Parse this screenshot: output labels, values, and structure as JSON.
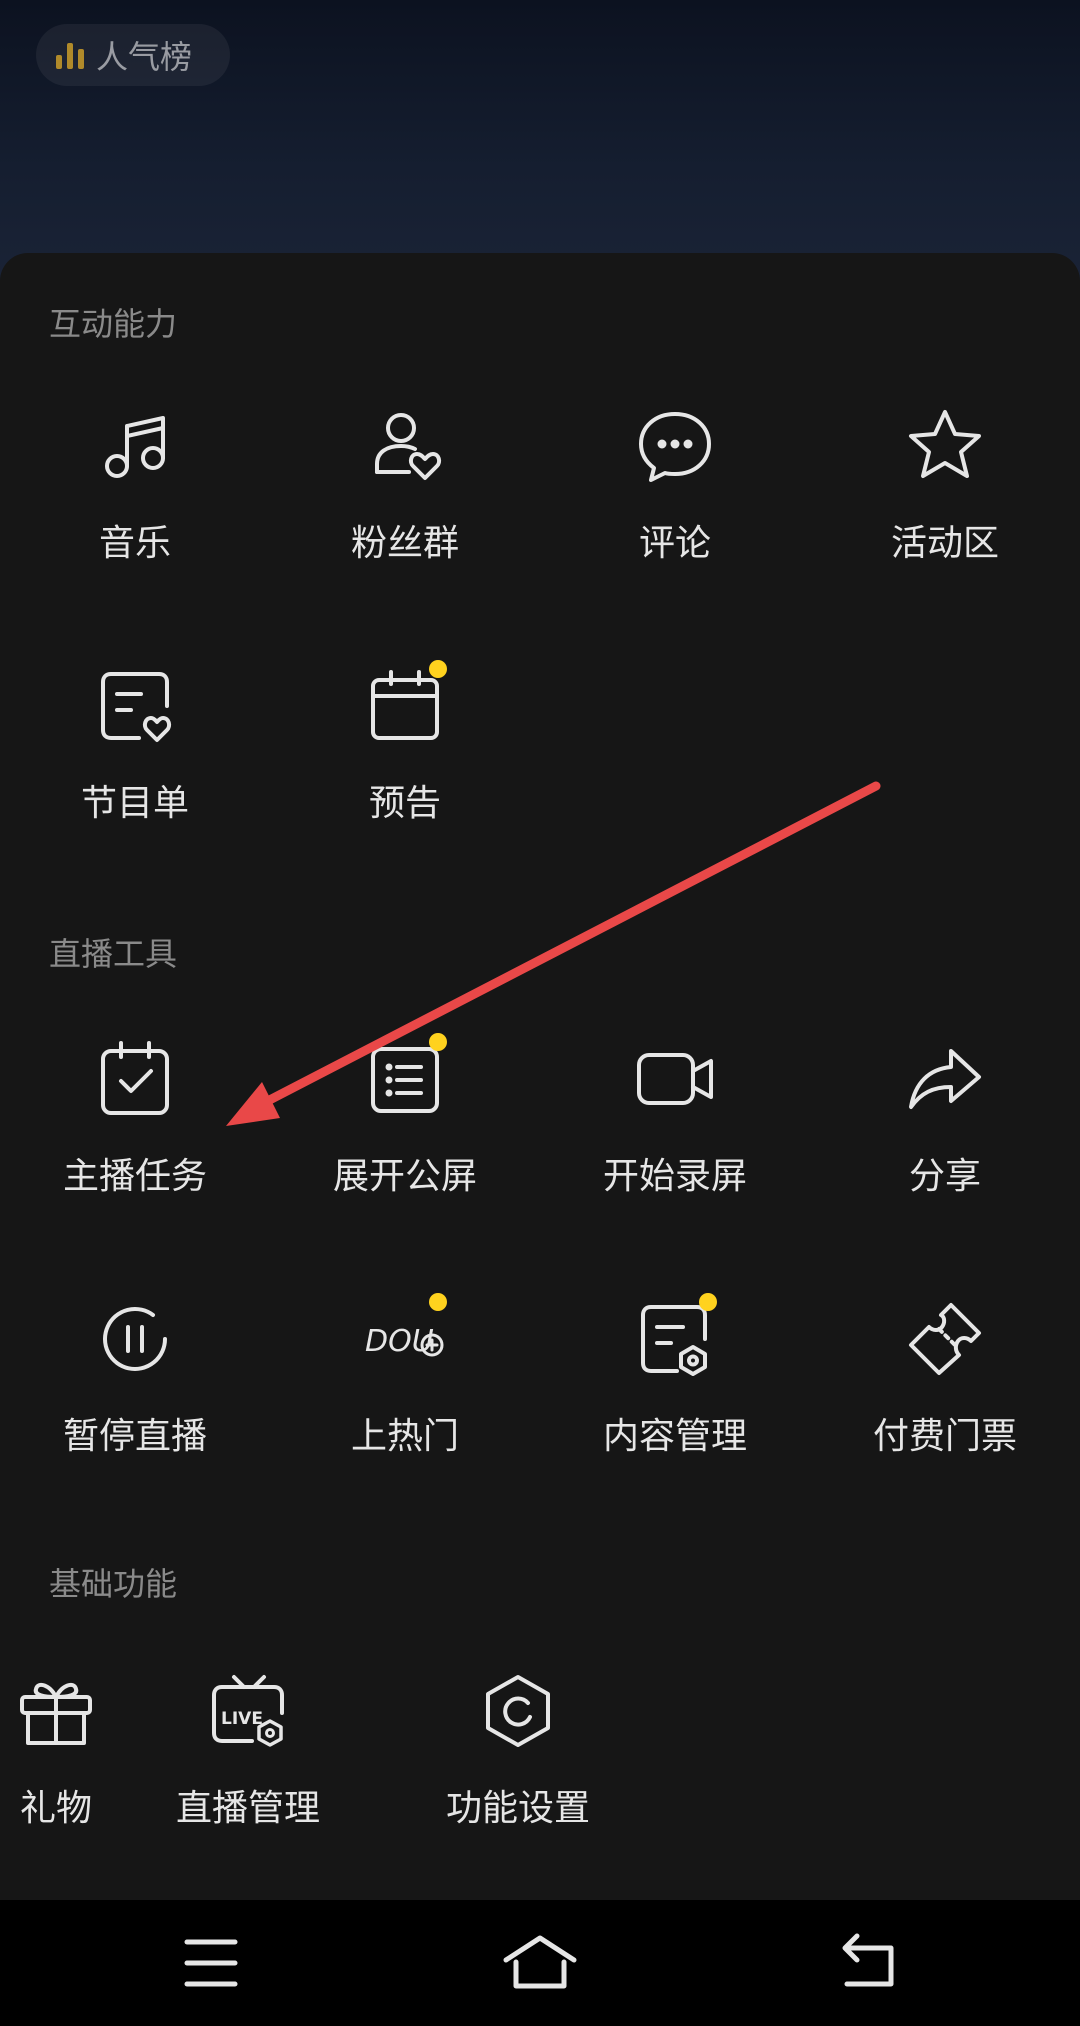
{
  "header": {
    "popularity_label": "人气榜"
  },
  "sections": [
    {
      "title": "互动能力",
      "items": [
        {
          "label": "音乐",
          "icon": "music-icon",
          "badge": false
        },
        {
          "label": "粉丝群",
          "icon": "fans-group-icon",
          "badge": false
        },
        {
          "label": "评论",
          "icon": "comment-icon",
          "badge": false
        },
        {
          "label": "活动区",
          "icon": "star-icon",
          "badge": false
        },
        {
          "label": "节目单",
          "icon": "program-list-icon",
          "badge": false
        },
        {
          "label": "预告",
          "icon": "calendar-icon",
          "badge": true
        }
      ]
    },
    {
      "title": "直播工具",
      "items": [
        {
          "label": "主播任务",
          "icon": "task-icon",
          "badge": false
        },
        {
          "label": "展开公屏",
          "icon": "public-screen-icon",
          "badge": true
        },
        {
          "label": "开始录屏",
          "icon": "record-icon",
          "badge": false
        },
        {
          "label": "分享",
          "icon": "share-icon",
          "badge": false
        },
        {
          "label": "暂停直播",
          "icon": "pause-icon",
          "badge": false
        },
        {
          "label": "上热门",
          "icon": "dou-plus-icon",
          "badge": true
        },
        {
          "label": "内容管理",
          "icon": "content-manage-icon",
          "badge": true
        },
        {
          "label": "付费门票",
          "icon": "ticket-icon",
          "badge": false
        }
      ]
    },
    {
      "title": "基础功能",
      "items": [
        {
          "label": "礼物",
          "icon": "gift-icon",
          "badge": false
        },
        {
          "label": "直播管理",
          "icon": "live-manage-icon",
          "badge": false
        },
        {
          "label": "功能设置",
          "icon": "settings-icon",
          "badge": false
        }
      ]
    }
  ],
  "annotation": {
    "arrow_color": "#e94848"
  },
  "colors": {
    "badge": "#ffd21e",
    "panel": "#161616",
    "label": "#e6e6e6",
    "section_title": "#8a8a8a"
  },
  "system_nav": [
    "menu-icon",
    "home-icon",
    "back-icon"
  ]
}
